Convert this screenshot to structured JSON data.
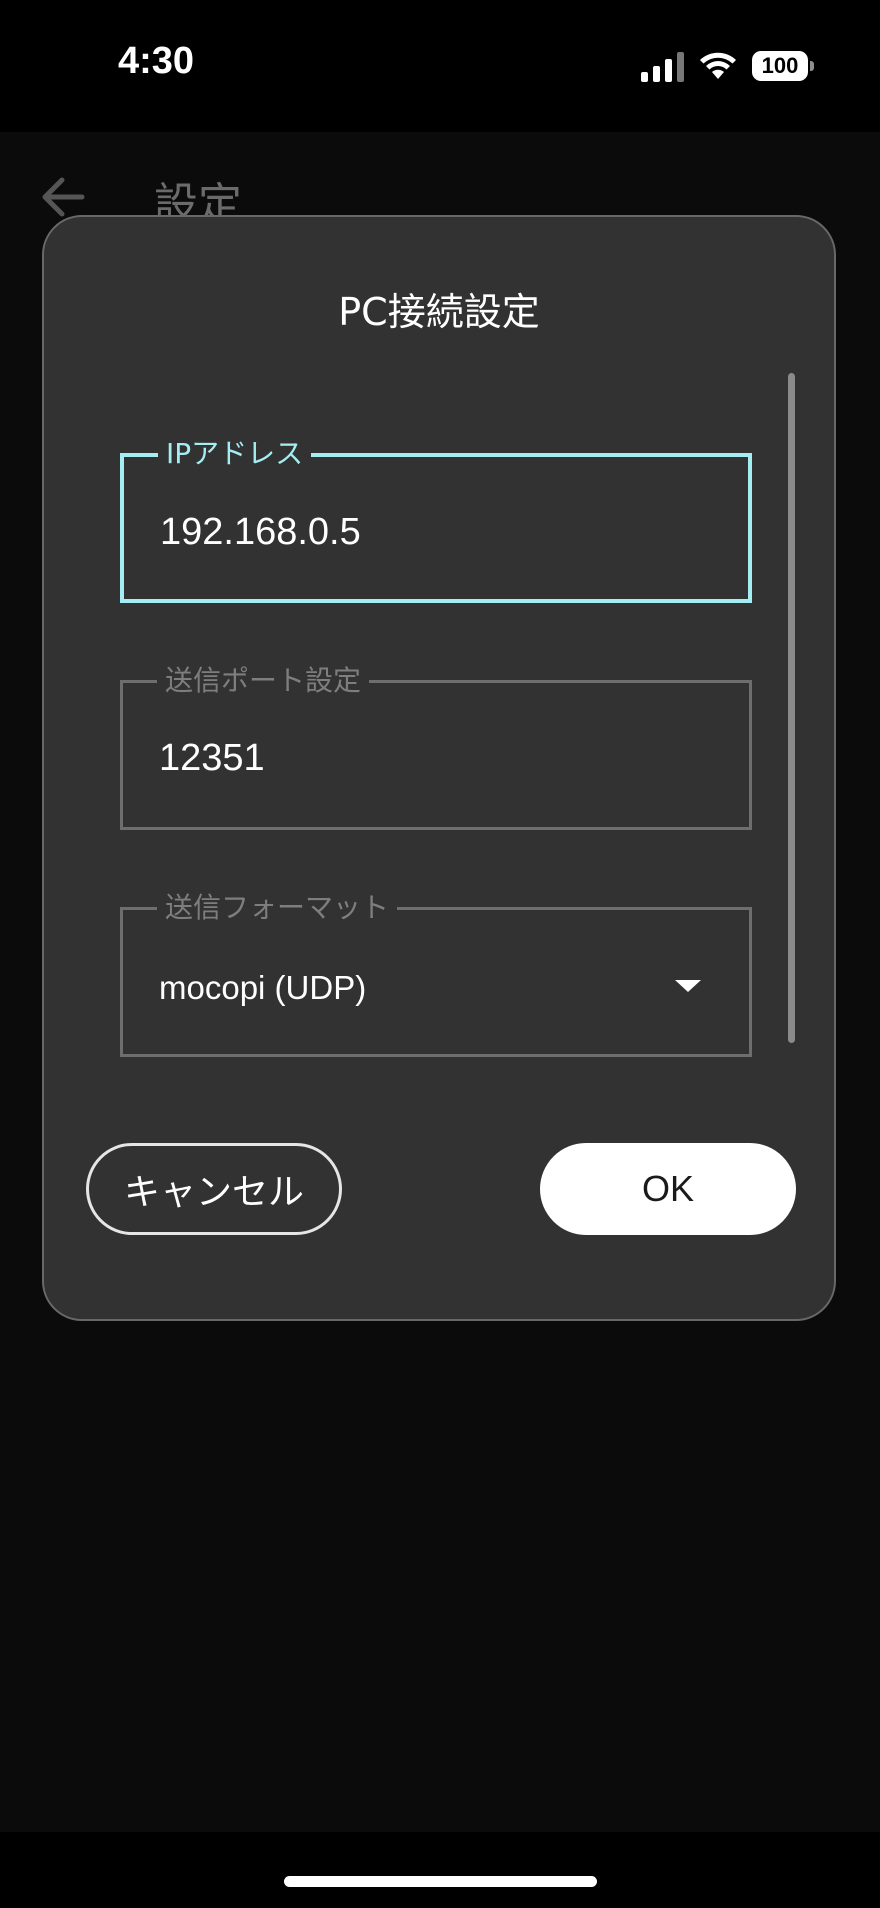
{
  "status_bar": {
    "time": "4:30",
    "battery": "100",
    "icons": [
      "signal-icon",
      "wifi-icon",
      "battery-icon"
    ]
  },
  "header": {
    "title": "設定",
    "back_icon": "back-arrow-icon"
  },
  "dialog": {
    "title": "PC接続設定",
    "fields": [
      {
        "label": "IPアドレス",
        "value": "192.168.0.5",
        "focused": true
      },
      {
        "label": "送信ポート設定",
        "value": "12351",
        "focused": false
      },
      {
        "label": "送信フォーマット",
        "value": "mocopi (UDP)",
        "focused": false,
        "type": "dropdown"
      }
    ],
    "cancel_label": "キャンセル",
    "ok_label": "OK"
  },
  "colors": {
    "accent": "#a4eef3",
    "dialog_bg": "#323232",
    "screen_bg": "#0b0b0b"
  }
}
